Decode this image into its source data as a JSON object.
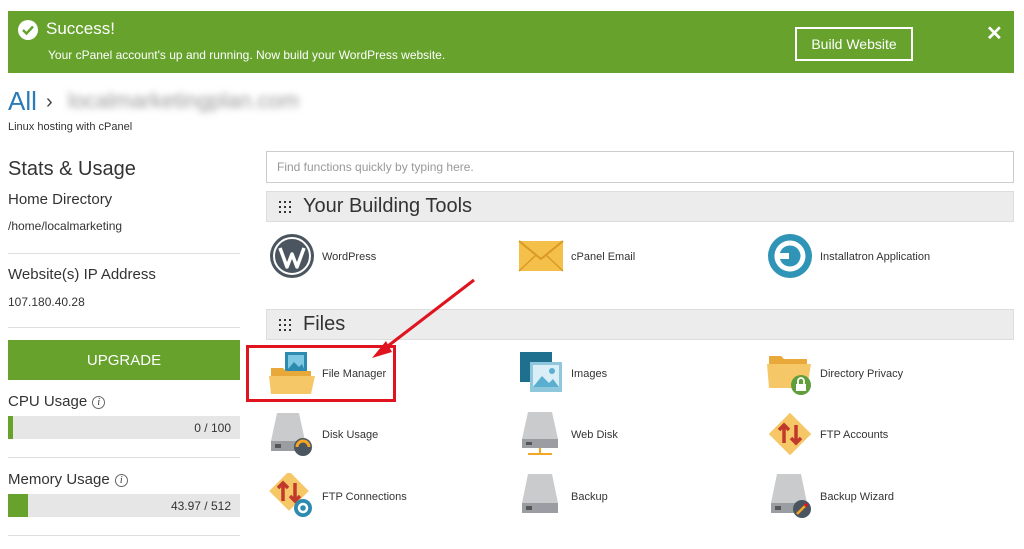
{
  "banner": {
    "title": "Success!",
    "message": "Your cPanel account's up and running. Now build your WordPress website.",
    "button": "Build Website",
    "close": "✕"
  },
  "breadcrumb": {
    "root": "All",
    "separator": "›",
    "domain": "localmarketingplan.com"
  },
  "subtitle": "Linux hosting with cPanel",
  "sidebar": {
    "heading": "Stats & Usage",
    "home_dir_label": "Home Directory",
    "home_dir_value": "/home/localmarketing",
    "ip_label": "Website(s) IP Address",
    "ip_value": "107.180.40.28",
    "upgrade": "UPGRADE",
    "cpu_label": "CPU Usage",
    "cpu_value": "0 / 100",
    "cpu_fraction": 0.02,
    "memory_label": "Memory Usage",
    "memory_value": "43.97 / 512",
    "memory_fraction": 0.086,
    "info": "i"
  },
  "search": {
    "placeholder": "Find functions quickly by typing here."
  },
  "sections": {
    "building": {
      "title": "Your Building Tools",
      "tools": [
        "WordPress",
        "cPanel Email",
        "Installatron Application"
      ]
    },
    "files": {
      "title": "Files",
      "tools": [
        "File Manager",
        "Images",
        "Directory Privacy",
        "Disk Usage",
        "Web Disk",
        "FTP Accounts",
        "FTP Connections",
        "Backup",
        "Backup Wizard"
      ]
    }
  },
  "colors": {
    "brand_green": "#66a22c",
    "link_blue": "#2b7bb9",
    "annotation_red": "#e0141e"
  }
}
